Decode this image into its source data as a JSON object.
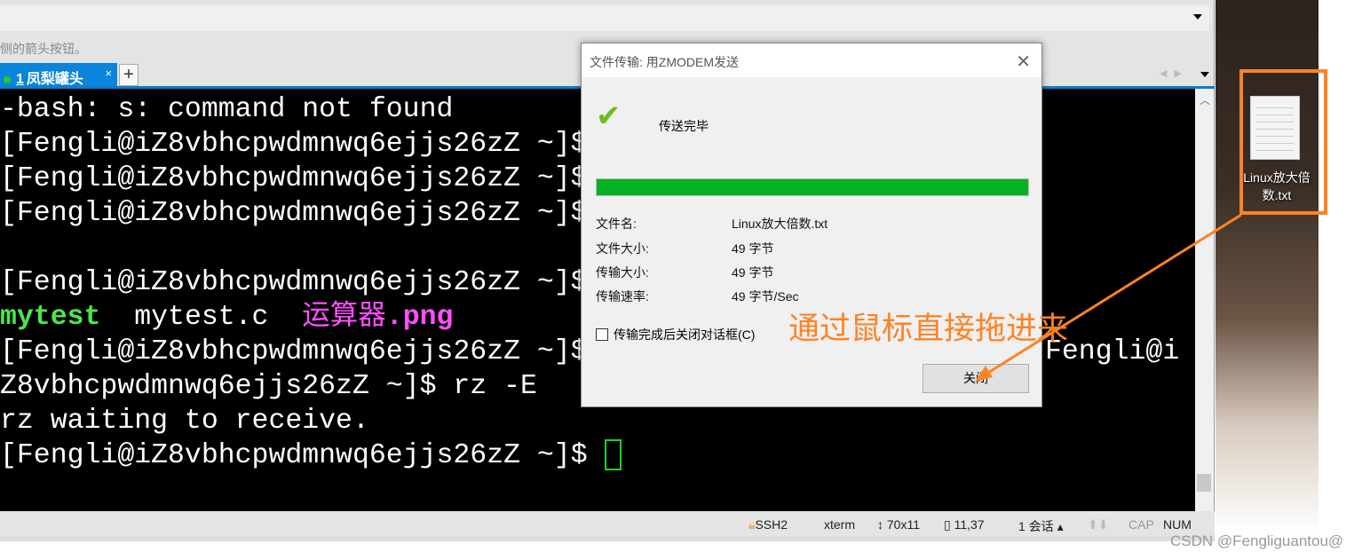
{
  "window": {
    "hint_text": "侧的箭头按钮。",
    "tab": {
      "index": "1",
      "label": "凤梨罐头",
      "close": "×"
    },
    "new_tab": "+"
  },
  "terminal": {
    "lines": [
      "-bash: s: command not found",
      "[Fengli@iZ8vbhcpwdmnwq6ejjs26zZ ~]$",
      "[Fengli@iZ8vbhcpwdmnwq6ejjs26zZ ~]$",
      "[Fengli@iZ8vbhcpwdmnwq6ejjs26zZ ~]$",
      "",
      "[Fengli@iZ8vbhcpwdmnwq6ejjs26zZ ~]$"
    ],
    "ls": {
      "exe": "mytest",
      "src": "mytest.c",
      "img_name": "运算器",
      "img_ext": ".png"
    },
    "line_wrap_left": "[Fengli@iZ8vbhcpwdmnwq6ejjs26zZ ~]$",
    "line_wrap_right": "Fengli@i",
    "rz_cmd": "Z8vbhcpwdmnwq6ejjs26zZ ~]$ rz -E",
    "rz_wait": "rz waiting to receive.",
    "prompt": "[Fengli@iZ8vbhcpwdmnwq6ejjs26zZ ~]$ "
  },
  "status": {
    "ssh": "SSH2",
    "term": "xterm",
    "size": "70x11",
    "pos": "11,37",
    "sessions": "1 会话",
    "cap": "CAP",
    "num": "NUM"
  },
  "dialog": {
    "title": "文件传输: 用ZMODEM发送",
    "status": "传送完毕",
    "progress_percent": 100,
    "fields": [
      {
        "label": "文件名:",
        "value": "Linux放大倍数.txt"
      },
      {
        "label": "文件大小:",
        "value": "49 字节"
      },
      {
        "label": "传输大小:",
        "value": "49 字节"
      },
      {
        "label": "传输速率:",
        "value": "49 字节/Sec"
      }
    ],
    "auto_close_label": "传输完成后关闭对话框(C)",
    "auto_close_checked": false,
    "close_button": "关闭"
  },
  "desktop": {
    "file_label": "Linux放大倍数.txt"
  },
  "annotation": "通过鼠标直接拖进来",
  "colors": {
    "accent": "#0a84dd",
    "progress": "#06b025",
    "annotation": "#ff8224"
  },
  "watermark": "CSDN @Fengliguantou@"
}
